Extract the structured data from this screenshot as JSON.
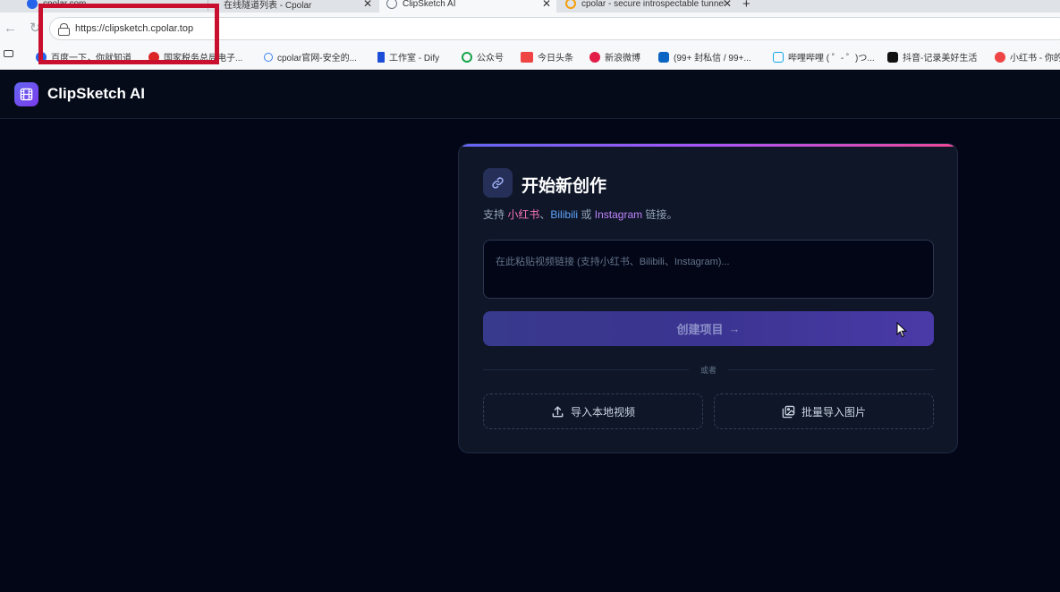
{
  "browser": {
    "tabs": [
      {
        "title": "cpolar.com",
        "icon_color": "#2563eb",
        "closable": true
      },
      {
        "title": "在线隧道列表 - Cpolar",
        "icon_color": "#9aa0a6",
        "closable": true
      },
      {
        "title": "ClipSketch AI",
        "icon_color": "#6b7280",
        "closable": true,
        "active": true
      },
      {
        "title": "cpolar - secure introspectable tunnel",
        "icon_color": "#f59e0b",
        "closable": false
      }
    ],
    "close_glyph": "✕",
    "new_tab_glyph": "+",
    "url": "https://clipsketch.cpolar.top",
    "bookmarks": [
      {
        "label": "百度一下，你就知道",
        "icon": "paw-icon",
        "color": "#2563eb",
        "glyph": "●"
      },
      {
        "label": "国家税务总局电子...",
        "icon": "emblem-icon",
        "color": "#dc2626",
        "glyph": "●"
      },
      {
        "label": "cpolar官网-安全的...",
        "icon": "search-icon",
        "color": "#3b82f6",
        "glyph": "○"
      },
      {
        "label": "工作室 - Dify",
        "icon": "dify-icon",
        "color": "#1d4ed8",
        "glyph": "▮"
      },
      {
        "label": "公众号",
        "icon": "wechat-icon",
        "color": "#16a34a",
        "glyph": "●"
      },
      {
        "label": "今日头条",
        "icon": "toutiao-icon",
        "color": "#ef4444",
        "glyph": "头"
      },
      {
        "label": "新浪微博",
        "icon": "weibo-icon",
        "color": "#e11d48",
        "glyph": "●"
      },
      {
        "label": "(99+ 封私信 / 99+...",
        "icon": "zhihu-icon",
        "color": "#0a66c2",
        "glyph": "知"
      },
      {
        "label": "哔哩哔哩 ( ゜- ゜)つ...",
        "icon": "bilibili-icon",
        "color": "#0ea5e9",
        "glyph": "▢"
      },
      {
        "label": "抖音-记录美好生活",
        "icon": "douyin-icon",
        "color": "#111111",
        "glyph": "♪"
      },
      {
        "label": "小红书 - 你的...",
        "icon": "xiaohongshu-icon",
        "color": "#ef4444",
        "glyph": "●"
      }
    ]
  },
  "app": {
    "name": "ClipSketch AI",
    "brand_color": "#6366f1"
  },
  "card": {
    "title": "开始新创作",
    "subtitle_prefix": "支持",
    "platform1": "小红书",
    "sep1": "、",
    "platform2": "Bilibili",
    "sep2": "或",
    "platform3": "Instagram",
    "subtitle_suffix": "链接。",
    "input_placeholder": "在此粘贴视频链接 (支持小红书、Bilibili、Instagram)...",
    "input_value": "",
    "create_label": "创建项目",
    "create_arrow": "→",
    "divider_label": "或者",
    "import_video_label": "导入本地视频",
    "batch_images_label": "批量导入图片"
  }
}
